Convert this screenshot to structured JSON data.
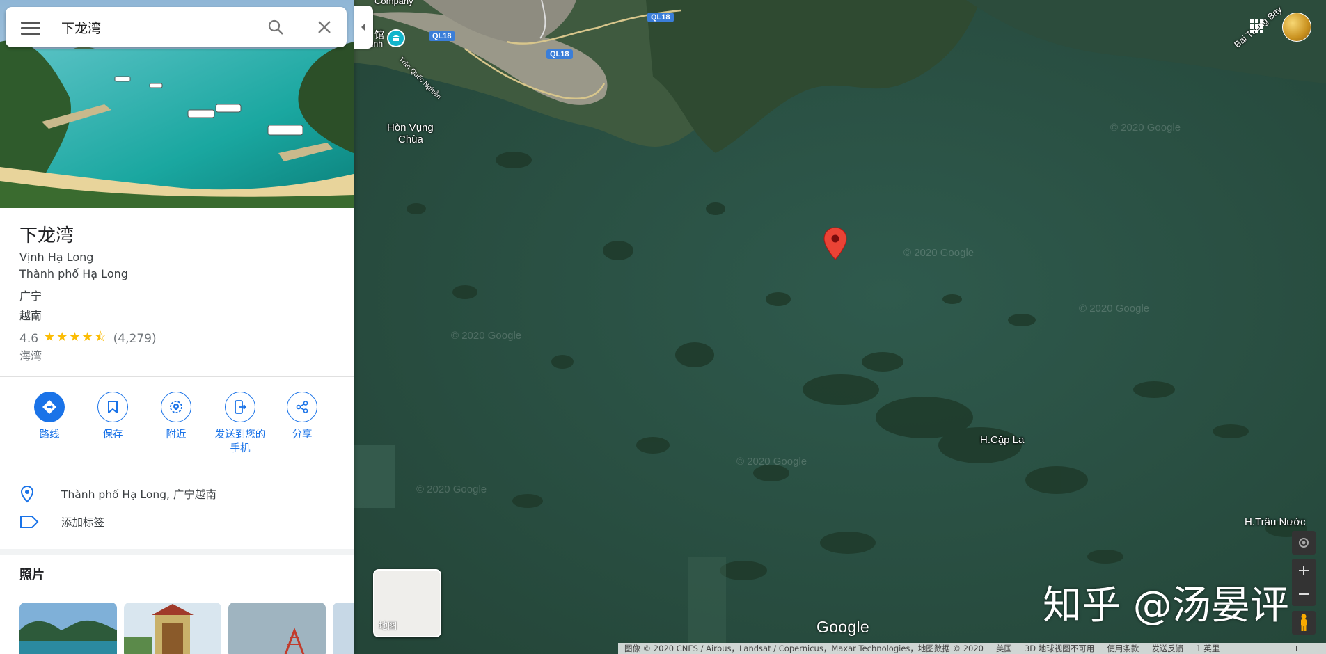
{
  "search": {
    "query": "下龙湾"
  },
  "place": {
    "title": "下龙湾",
    "address_lines": [
      "Vịnh Hạ Long",
      "Thành phố Hạ Long",
      "广宁",
      "越南"
    ],
    "rating": "4.6",
    "stars": "★★★★⯪",
    "review_count": "(4,279)",
    "category": "海湾"
  },
  "actions": [
    {
      "label": "路线",
      "icon": "directions-icon"
    },
    {
      "label": "保存",
      "icon": "bookmark-icon"
    },
    {
      "label": "附近",
      "icon": "nearby-icon"
    },
    {
      "label": "发送到您的手机",
      "label_line1": "发送到您的",
      "label_line2": "手机",
      "icon": "send-to-phone-icon"
    },
    {
      "label": "分享",
      "icon": "share-icon"
    }
  ],
  "info": {
    "address": "Thành phố Hạ Long, 广宁越南",
    "add_label": "添加标签"
  },
  "photos": {
    "heading": "照片"
  },
  "map": {
    "labels": {
      "hon_vung_chua_1": "Hòn Vụng",
      "hon_vung_chua_2": "Chùa",
      "cap_la": "H.Cặp La",
      "trau_nuoc": "H.Trâu Nước",
      "bai_tuong": "Bai Tuong Bay",
      "museum": "馆",
      "museum2": "inh",
      "road_1": "Trần Quốc Nghiễn",
      "top_label": "Company"
    },
    "road_badges": [
      "QL18",
      "QL18",
      "QL18"
    ],
    "watermark": "© 2020 Google",
    "layer_label": "地图",
    "google": "Google"
  },
  "footer": {
    "imagery": "图像 © 2020 CNES / Airbus，Landsat / Copernicus，Maxar Technologies，地图数据 © 2020",
    "country": "美国",
    "view3d": "3D 地球视图不可用",
    "terms": "使用条款",
    "feedback": "发送反馈",
    "scale": "1 英里"
  },
  "overlay_watermark": "知乎 @汤晏评",
  "colors": {
    "accent": "#1a73e8",
    "star": "#fbbc04",
    "pin": "#ea4335",
    "water": "#2d5446"
  }
}
